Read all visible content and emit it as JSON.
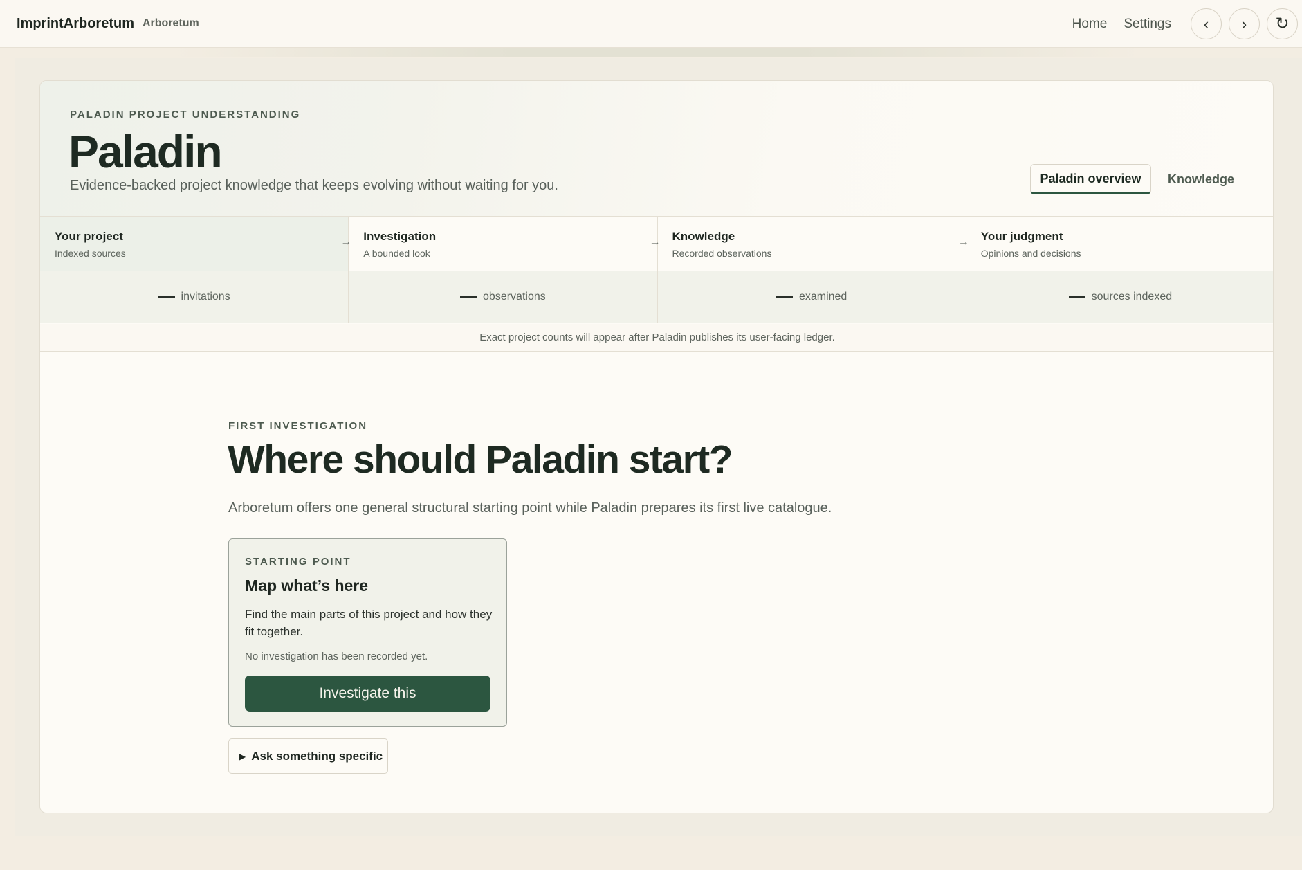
{
  "topbar": {
    "brand": "ImprintArboretum",
    "brand_sub": "Arboretum",
    "nav": [
      "Home",
      "Settings"
    ],
    "back_glyph": "‹",
    "forward_glyph": "›",
    "refresh_glyph": "↻"
  },
  "hero": {
    "eyebrow": "PALADIN PROJECT UNDERSTANDING",
    "title": "Paladin",
    "description": "Evidence-backed project knowledge that keeps evolving without waiting for you.",
    "tabs": [
      {
        "label": "Paladin overview",
        "active": true
      },
      {
        "label": "Knowledge",
        "active": false
      }
    ]
  },
  "steps": [
    {
      "title": "Your project",
      "subtitle": "Indexed sources",
      "active": true
    },
    {
      "title": "Investigation",
      "subtitle": "A bounded look",
      "active": false
    },
    {
      "title": "Knowledge",
      "subtitle": "Recorded observations",
      "active": false
    },
    {
      "title": "Your judgment",
      "subtitle": "Opinions and decisions",
      "active": false
    }
  ],
  "step_arrow": "→",
  "counts": [
    {
      "value": "—",
      "label": "invitations"
    },
    {
      "value": "—",
      "label": "observations"
    },
    {
      "value": "—",
      "label": "examined"
    },
    {
      "value": "—",
      "label": "sources indexed"
    }
  ],
  "ledger_note": "Exact project counts will appear after Paladin publishes its user-facing ledger.",
  "first_investigation": {
    "eyebrow": "FIRST INVESTIGATION",
    "title": "Where should Paladin start?",
    "description": "Arboretum offers one general structural starting point while Paladin prepares its first live catalogue.",
    "starting_point": {
      "eyebrow": "STARTING POINT",
      "title": "Map what’s here",
      "description": "Find the main parts of this project and how they fit together.",
      "status": "No investigation has been recorded yet.",
      "button": "Investigate this"
    },
    "ask": {
      "caret": "▶",
      "label": "Ask something specific"
    }
  },
  "colors": {
    "accent": "#2c5640",
    "background": "#f3ede2",
    "card": "#fdfbf6",
    "text": "#1e2a22"
  }
}
